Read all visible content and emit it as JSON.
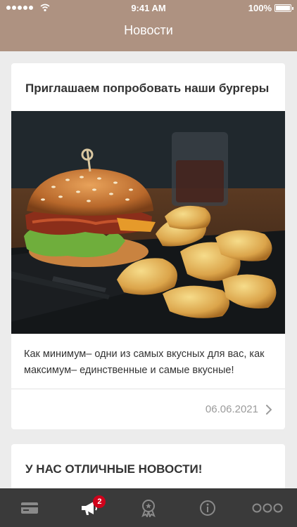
{
  "status_bar": {
    "time": "9:41 AM",
    "battery": "100%"
  },
  "header": {
    "title": "Новости"
  },
  "news": [
    {
      "title": "Приглашаем попробовать наши бургеры",
      "text": "Как минимум– одни из самых вкусных для вас, как максимум– единственные и самые вкусные!",
      "date": "06.06.2021"
    },
    {
      "title": "У НАС ОТЛИЧНЫЕ НОВОСТИ!"
    }
  ],
  "tabbar": {
    "items": [
      {
        "icon": "card-icon"
      },
      {
        "icon": "megaphone-icon",
        "badge": "2"
      },
      {
        "icon": "award-icon"
      },
      {
        "icon": "info-icon"
      },
      {
        "icon": "more-icon"
      }
    ]
  },
  "colors": {
    "header": "#ae9281",
    "tabbar": "#3a3a3a",
    "badge": "#d0021b",
    "background": "#ececec"
  }
}
